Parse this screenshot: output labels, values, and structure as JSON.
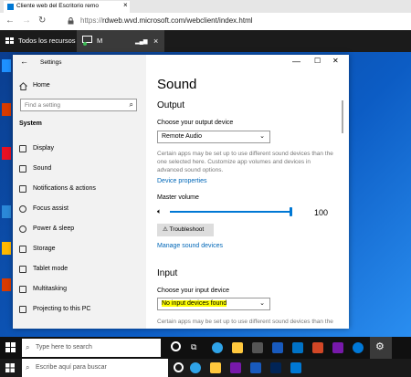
{
  "browser": {
    "tab_title": "Cliente web del Escritorio remo",
    "close_glyph": "×",
    "url_prefix": "https://",
    "url": "rdweb.wvd.microsoft.com/webclient/index.html"
  },
  "rd_bar": {
    "resources_label": "Todos los recursos",
    "session_label": "M",
    "close_glyph": "×"
  },
  "settings": {
    "window_title": "Settings",
    "home_label": "Home",
    "find_placeholder": "Find a setting",
    "section_label": "System",
    "nav_items": [
      {
        "label": "Display",
        "icon": "display-icon"
      },
      {
        "label": "Sound",
        "icon": "sound-icon"
      },
      {
        "label": "Notifications & actions",
        "icon": "notifications-icon"
      },
      {
        "label": "Focus assist",
        "icon": "focus-assist-icon"
      },
      {
        "label": "Power & sleep",
        "icon": "power-icon"
      },
      {
        "label": "Storage",
        "icon": "storage-icon"
      },
      {
        "label": "Tablet mode",
        "icon": "tablet-icon"
      },
      {
        "label": "Multitasking",
        "icon": "multitasking-icon"
      },
      {
        "label": "Projecting to this PC",
        "icon": "projecting-icon"
      }
    ],
    "page_title": "Sound",
    "output_heading": "Output",
    "output_device_label": "Choose your output device",
    "output_device_value": "Remote Audio",
    "output_note": "Certain apps may be set up to use different sound devices than the one selected here. Customize app volumes and devices in advanced sound options.",
    "device_properties_link": "Device properties",
    "master_volume_label": "Master volume",
    "volume_value": "100",
    "volume_level": 1.0,
    "troubleshoot_label": "Troubleshoot",
    "manage_devices_link": "Manage sound devices",
    "input_heading": "Input",
    "input_device_label": "Choose your input device",
    "input_device_value": "No input devices found",
    "input_note": "Certain apps may be set up to use different sound devices than the",
    "minimize_glyph": "—",
    "maximize_glyph": "☐",
    "close_glyph": "✕"
  },
  "taskbar": {
    "search_placeholder_en": "Type here to search",
    "search_placeholder_es": "Escribe aquí para buscar"
  },
  "colors": {
    "accent": "#0078d4",
    "highlight": "#ffff00"
  }
}
